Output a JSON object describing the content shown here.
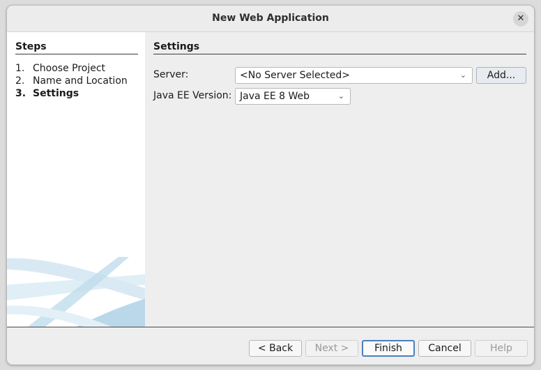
{
  "window": {
    "title": "New Web Application",
    "close_glyph": "✕"
  },
  "steps": {
    "header": "Steps",
    "items": [
      {
        "num": "1.",
        "label": "Choose Project",
        "current": false
      },
      {
        "num": "2.",
        "label": "Name and Location",
        "current": false
      },
      {
        "num": "3.",
        "label": "Settings",
        "current": true
      }
    ]
  },
  "settings": {
    "header": "Settings",
    "server_label": "Server:",
    "server_value": "<No Server Selected>",
    "add_label": "Add...",
    "javaee_label": "Java EE Version:",
    "javaee_value": "Java EE 8 Web"
  },
  "buttons": {
    "back": "< Back",
    "next": "Next >",
    "finish": "Finish",
    "cancel": "Cancel",
    "help": "Help"
  },
  "icons": {
    "dropdown": "chevron-down-icon",
    "close": "close-icon"
  },
  "colors": {
    "default_button_border": "#4a7fbe",
    "art": "#bcd9ea"
  }
}
